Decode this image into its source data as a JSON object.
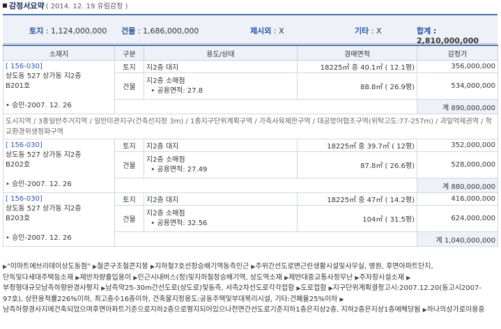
{
  "header": {
    "title": "감정서요약",
    "subtitle": "( 2014. 12. 19  유림감정 )"
  },
  "summary": {
    "land_label": "토지",
    "land_value": ": 1,124,000,000",
    "bldg_label": "건물",
    "bldg_value": ": 1,686,000,000",
    "extra_label": "제시외",
    "extra_value": ": X",
    "etc_label": "기타",
    "etc_value": ": X",
    "total_label": "합계",
    "total_value": ": 2,810,000,000"
  },
  "columns": [
    "소재지",
    "구분",
    "용도/상태",
    "경매면적",
    "감정가"
  ],
  "units": [
    {
      "code": "[ 156-030]",
      "addr1": "상도동 527 상가동 지2층",
      "addr2": "B201호",
      "approval": "• 승인-2007. 12. 26",
      "land_type": "토지",
      "land_use": "지2층  대지",
      "land_area": "18225㎡ 중 40.1㎡   ( 12.1평)",
      "land_price": "356,000,000",
      "bldg_type": "건물",
      "bldg_use": "지2층  소매점",
      "bldg_common": "• 공용면적: 27.8",
      "bldg_area": "88.8㎡   ( 26.9평)",
      "bldg_price": "534,000,000",
      "subtotal": "계  890,000,000"
    },
    {
      "code": "[ 156-030]",
      "addr1": "상도동 527 상가동 지2층",
      "addr2": "B202호",
      "approval": "• 승인-2007. 12. 26",
      "land_type": "토지",
      "land_use": "지2층  대지",
      "land_area": "18225㎡ 중 39.7㎡   ( 12평)",
      "land_price": "352,000,000",
      "bldg_type": "건물",
      "bldg_use": "지2층  소매점",
      "bldg_common": "• 공용면적: 27.49",
      "bldg_area": "87.8㎡   ( 26.6평)",
      "bldg_price": "528,000,000",
      "subtotal": "계  880,000,000"
    },
    {
      "code": "[ 156-030]",
      "addr1": "상도동 527 상가동 지2층",
      "addr2": "B203호",
      "approval": "• 승인-2007. 12. 26",
      "land_type": "토지",
      "land_use": "지2층  대지",
      "land_area": "18225㎡ 중 47㎡   ( 14.2평)",
      "land_price": "416,000,000",
      "bldg_type": "건물",
      "bldg_use": "지2층  소매점",
      "bldg_common": "• 공용면적: 32.56",
      "bldg_area": "104㎡   ( 31.5평)",
      "bldg_price": "624,000,000",
      "subtotal": "계  1,040,000,000"
    }
  ],
  "zoning": "도시지역 / 3종일반주거지역 / 일반미관지구(건축선지정 3m) / 1종지구단위계획구역 / 가축사육제한구역 / 대공방어협조구역(위탁고도:77-257m) / 과밀억제권역 / 학교환경위생정화구역",
  "notes": [
    "\"이마트에브리데이상도동점\"",
    "철콘구조철콘지붕",
    "지하철7호선장승배기역동측인근",
    "주위간선도로변근린생활시설및사무실, 병원, 후면아파트단지, 단독및다세대주택등소재",
    "제반차량출입용이",
    "인근시내버스(정)및지하철장승배기역, 상도역소재",
    "제반대중교통사정무난",
    "주차장시설소재",
    "부정형대규모남측하향완경사평지",
    "남측약25-30m간선도로(상도로)및동측, 서측2차선도로각각접함",
    "도로접함",
    "지구단위계획결정고시:2007.12.20(동고시2007-97호), 상한용적률226%이하, 최고층수16층이하, 건축물지정용도:공동주택및부대복리시설, 기타:건폐율25%이하",
    "남측하향경사지에건축되었으며후면아파트기준으로지하2층으로평지되어있으나전면간선도로기준지하1층은지상2층, 지하2층은지상1층에해당됨",
    "하나의상가로이용중"
  ]
}
